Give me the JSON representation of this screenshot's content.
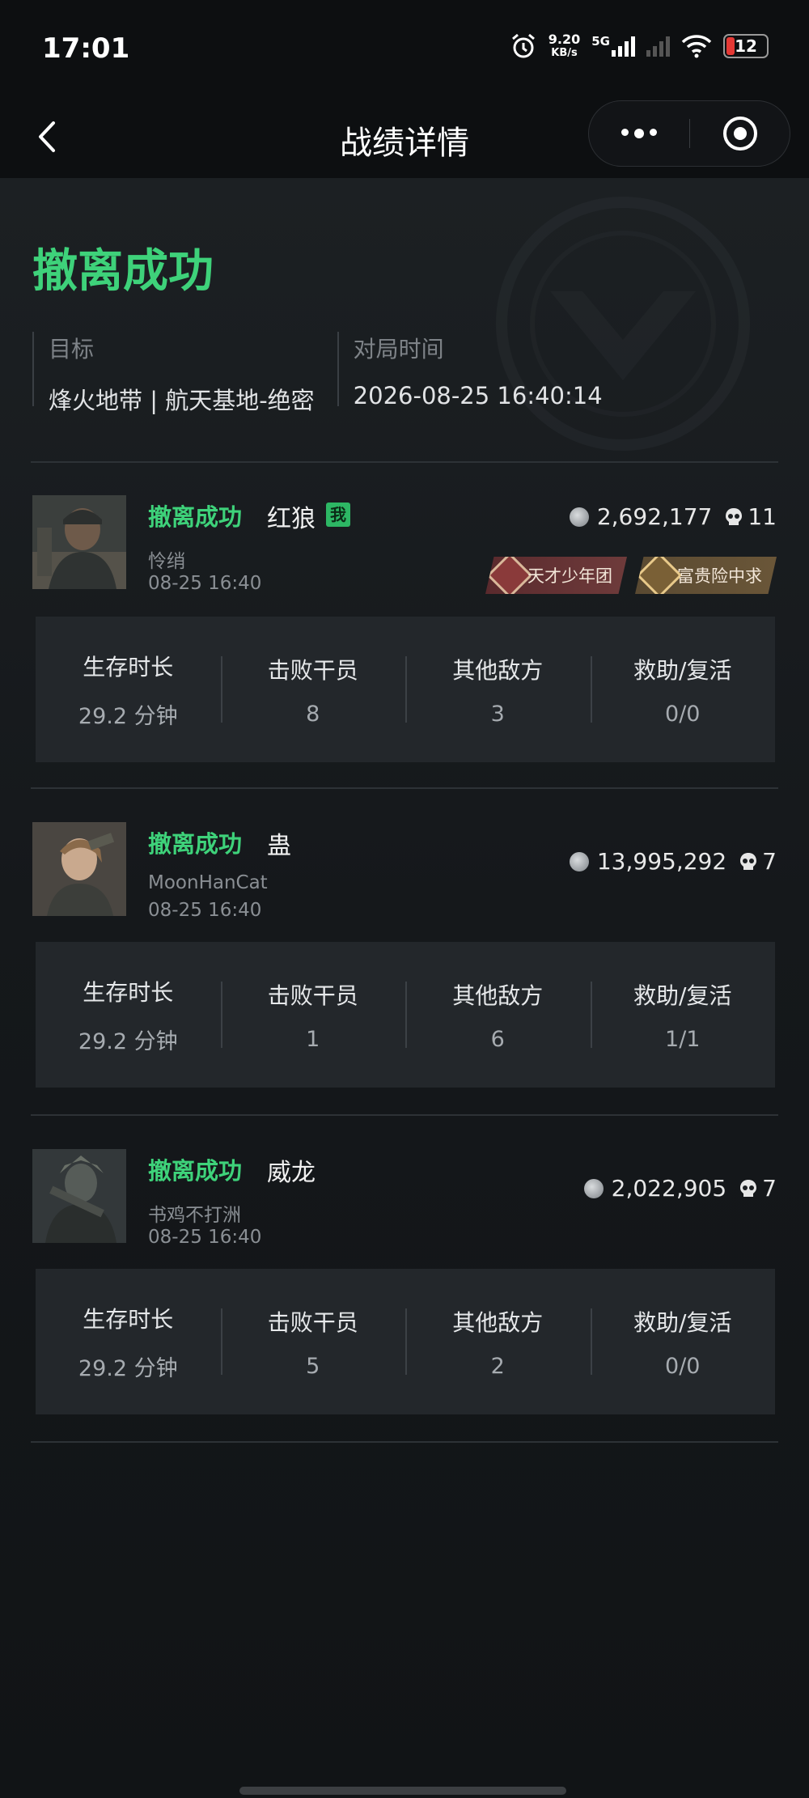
{
  "status_bar": {
    "time": "17:01",
    "net_speed_value": "9.20",
    "net_speed_unit": "KB/s",
    "network": "5G",
    "battery": "12"
  },
  "nav": {
    "title": "战绩详情"
  },
  "header": {
    "result": "撤离成功",
    "target_label": "目标",
    "target_value": "烽火地带 | 航天基地-绝密",
    "time_label": "对局时间",
    "time_value": "2026-08-25 16:40:14"
  },
  "stat_labels": [
    "生存时长",
    "击败干员",
    "其他敌方",
    "救助/复活"
  ],
  "players": [
    {
      "status": "撤离成功",
      "name": "红狼",
      "me_badge": "我",
      "nickname": "怜绡",
      "time": "08-25 16:40",
      "value": "2,692,177",
      "kills": "11",
      "badges": [
        {
          "label": "天才少年团",
          "style": "red"
        },
        {
          "label": "富贵险中求",
          "style": "gold"
        }
      ],
      "stats": [
        "29.2 分钟",
        "8",
        "3",
        "0/0"
      ]
    },
    {
      "status": "撤离成功",
      "name": "蛊",
      "nickname": "MoonHanCat",
      "time": "08-25 16:40",
      "value": "13,995,292",
      "kills": "7",
      "stats": [
        "29.2 分钟",
        "1",
        "6",
        "1/1"
      ]
    },
    {
      "status": "撤离成功",
      "name": "威龙",
      "nickname": "书鸡不打洲",
      "time": "08-25 16:40",
      "value": "2,022,905",
      "kills": "7",
      "stats": [
        "29.2 分钟",
        "5",
        "2",
        "0/0"
      ]
    }
  ]
}
